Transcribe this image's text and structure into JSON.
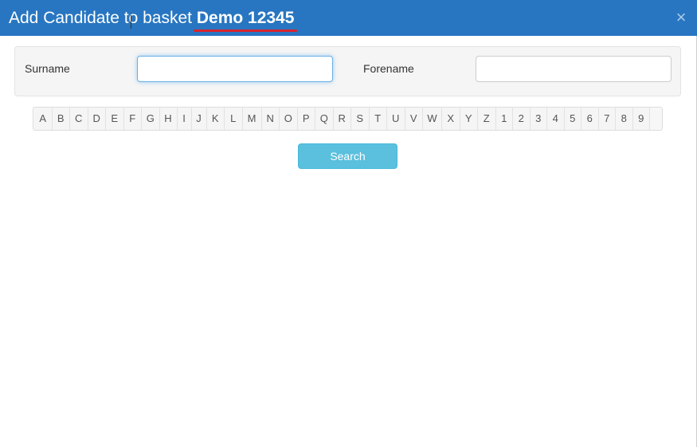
{
  "dialog": {
    "title_prefix": "Add Candidate to basket",
    "basket_name": "Demo 12345",
    "close_glyph": "×",
    "colors": {
      "titlebar": "#2876c1",
      "underline": "#d9232e",
      "search_button": "#5bc0de"
    }
  },
  "search_form": {
    "surname_label": "Surname",
    "surname_value": "",
    "forename_label": "Forename",
    "forename_value": ""
  },
  "alpha_filter": {
    "keys": [
      "A",
      "B",
      "C",
      "D",
      "E",
      "F",
      "G",
      "H",
      "I",
      "J",
      "K",
      "L",
      "M",
      "N",
      "O",
      "P",
      "Q",
      "R",
      "S",
      "T",
      "U",
      "V",
      "W",
      "X",
      "Y",
      "Z",
      "1",
      "2",
      "3",
      "4",
      "5",
      "6",
      "7",
      "8",
      "9"
    ]
  },
  "actions": {
    "search_label": "Search"
  }
}
